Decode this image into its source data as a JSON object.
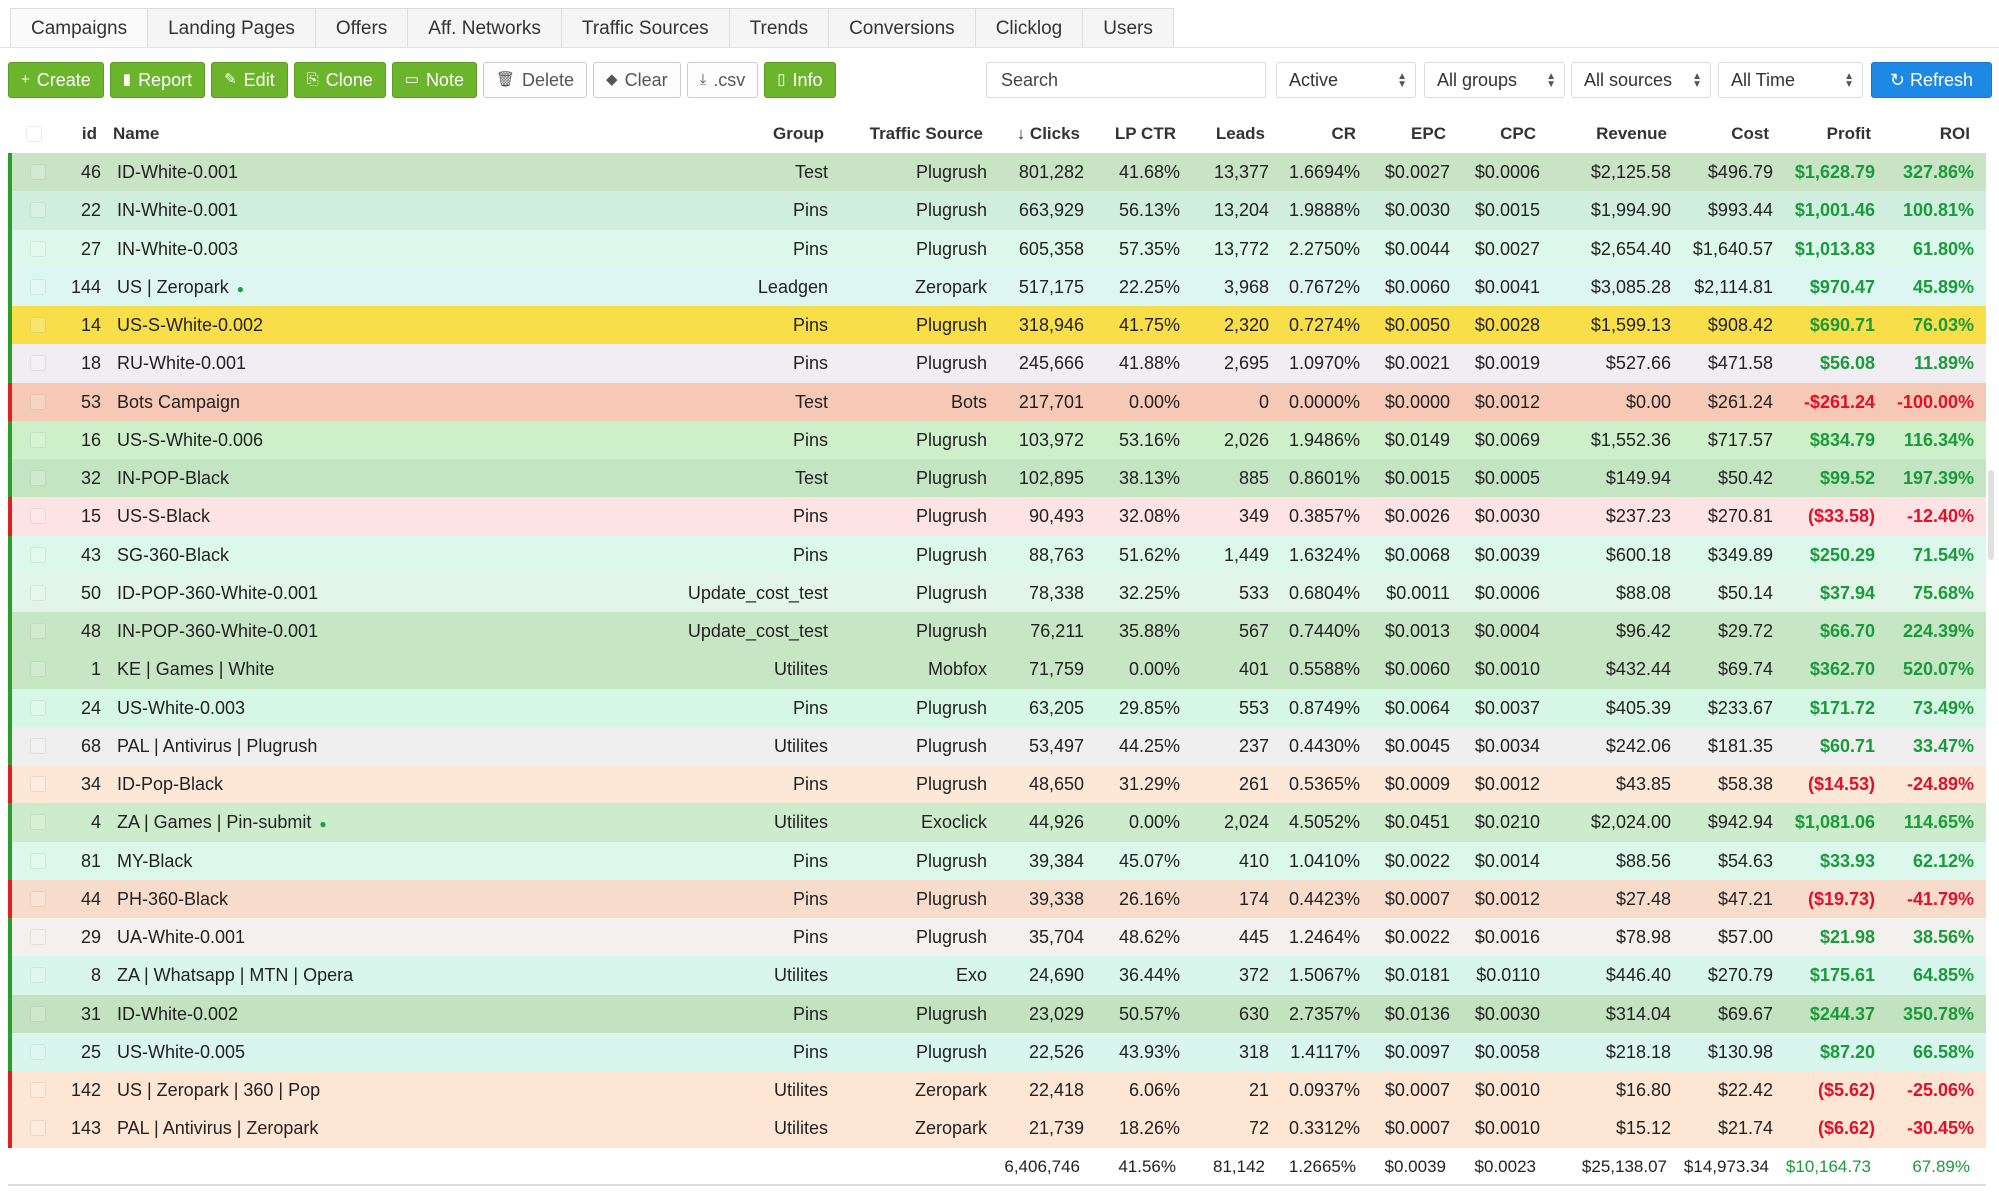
{
  "tabs": [
    "Campaigns",
    "Landing Pages",
    "Offers",
    "Aff. Networks",
    "Traffic Sources",
    "Trends",
    "Conversions",
    "Clicklog",
    "Users"
  ],
  "toolbar": {
    "buttons": [
      {
        "label": "Create",
        "icon": "plus-icon",
        "style": "green"
      },
      {
        "label": "Report",
        "icon": "bar-chart-icon",
        "style": "green"
      },
      {
        "label": "Edit",
        "icon": "pencil-icon",
        "style": "green"
      },
      {
        "label": "Clone",
        "icon": "copy-icon",
        "style": "green"
      },
      {
        "label": "Note",
        "icon": "note-icon",
        "style": "green"
      },
      {
        "label": "Delete",
        "icon": "trash-icon",
        "style": "white"
      },
      {
        "label": "Clear",
        "icon": "eraser-icon",
        "style": "white"
      },
      {
        "label": ".csv",
        "icon": "download-icon",
        "style": "white"
      },
      {
        "label": "Info",
        "icon": "file-icon",
        "style": "green"
      }
    ],
    "search_placeholder": "Search",
    "filters": [
      "Active",
      "All groups",
      "All sources",
      "All Time"
    ],
    "refresh_label": "Refresh"
  },
  "table": {
    "columns": [
      "id",
      "Name",
      "Group",
      "Traffic Source",
      "Clicks",
      "LP CTR",
      "Leads",
      "CR",
      "EPC",
      "CPC",
      "Revenue",
      "Cost",
      "Profit",
      "ROI"
    ],
    "sort_column": "Clicks",
    "sort_direction": "desc",
    "rows": [
      {
        "id": "46",
        "name": "ID-White-0.001",
        "group": "Test",
        "source": "Plugrush",
        "clicks": "801,282",
        "lpctr": "41.68%",
        "leads": "13,377",
        "cr": "1.6694%",
        "epc": "$0.0027",
        "cpc": "$0.0006",
        "revenue": "$2,125.58",
        "cost": "$496.79",
        "profit": "$1,628.79",
        "roi": "327.86%",
        "bg": "#c9e4c5",
        "status": "positive"
      },
      {
        "id": "22",
        "name": "IN-White-0.001",
        "group": "Pins",
        "source": "Plugrush",
        "clicks": "663,929",
        "lpctr": "56.13%",
        "leads": "13,204",
        "cr": "1.9888%",
        "epc": "$0.0030",
        "cpc": "$0.0015",
        "revenue": "$1,994.90",
        "cost": "$993.44",
        "profit": "$1,001.46",
        "roi": "100.81%",
        "bg": "#cfeedd",
        "status": "positive"
      },
      {
        "id": "27",
        "name": "IN-White-0.003",
        "group": "Pins",
        "source": "Plugrush",
        "clicks": "605,358",
        "lpctr": "57.35%",
        "leads": "13,772",
        "cr": "2.2750%",
        "epc": "$0.0044",
        "cpc": "$0.0027",
        "revenue": "$2,654.40",
        "cost": "$1,640.57",
        "profit": "$1,013.83",
        "roi": "61.80%",
        "bg": "#dcf8ec",
        "status": "positive"
      },
      {
        "id": "144",
        "name": "US | Zeropark",
        "dot": true,
        "group": "Leadgen",
        "source": "Zeropark",
        "clicks": "517,175",
        "lpctr": "22.25%",
        "leads": "3,968",
        "cr": "0.7672%",
        "epc": "$0.0060",
        "cpc": "$0.0041",
        "revenue": "$3,085.28",
        "cost": "$2,114.81",
        "profit": "$970.47",
        "roi": "45.89%",
        "bg": "#ddf6f2",
        "status": "positive"
      },
      {
        "id": "14",
        "name": "US-S-White-0.002",
        "group": "Pins",
        "source": "Plugrush",
        "clicks": "318,946",
        "lpctr": "41.75%",
        "leads": "2,320",
        "cr": "0.7274%",
        "epc": "$0.0050",
        "cpc": "$0.0028",
        "revenue": "$1,599.13",
        "cost": "$908.42",
        "profit": "$690.71",
        "roi": "76.03%",
        "bg": "#f8df4a",
        "status": "positive"
      },
      {
        "id": "18",
        "name": "RU-White-0.001",
        "group": "Pins",
        "source": "Plugrush",
        "clicks": "245,666",
        "lpctr": "41.88%",
        "leads": "2,695",
        "cr": "1.0970%",
        "epc": "$0.0021",
        "cpc": "$0.0019",
        "revenue": "$527.66",
        "cost": "$471.58",
        "profit": "$56.08",
        "roi": "11.89%",
        "bg": "#f1eef3",
        "status": "positive"
      },
      {
        "id": "53",
        "name": "Bots Campaign",
        "group": "Test",
        "source": "Bots",
        "clicks": "217,701",
        "lpctr": "0.00%",
        "leads": "0",
        "cr": "0.0000%",
        "epc": "$0.0000",
        "cpc": "$0.0012",
        "revenue": "$0.00",
        "cost": "$261.24",
        "profit": "-$261.24",
        "roi": "-100.00%",
        "bg": "#f6c8b6",
        "status": "negative"
      },
      {
        "id": "16",
        "name": "US-S-White-0.006",
        "group": "Pins",
        "source": "Plugrush",
        "clicks": "103,972",
        "lpctr": "53.16%",
        "leads": "2,026",
        "cr": "1.9486%",
        "epc": "$0.0149",
        "cpc": "$0.0069",
        "revenue": "$1,552.36",
        "cost": "$717.57",
        "profit": "$834.79",
        "roi": "116.34%",
        "bg": "#cdf0c9",
        "status": "positive"
      },
      {
        "id": "32",
        "name": "IN-POP-Black",
        "group": "Test",
        "source": "Plugrush",
        "clicks": "102,895",
        "lpctr": "38.13%",
        "leads": "885",
        "cr": "0.8601%",
        "epc": "$0.0015",
        "cpc": "$0.0005",
        "revenue": "$149.94",
        "cost": "$50.42",
        "profit": "$99.52",
        "roi": "197.39%",
        "bg": "#c3e5c2",
        "status": "positive"
      },
      {
        "id": "15",
        "name": "US-S-Black",
        "group": "Pins",
        "source": "Plugrush",
        "clicks": "90,493",
        "lpctr": "32.08%",
        "leads": "349",
        "cr": "0.3857%",
        "epc": "$0.0026",
        "cpc": "$0.0030",
        "revenue": "$237.23",
        "cost": "$270.81",
        "profit": "($33.58)",
        "roi": "-12.40%",
        "bg": "#fde3e3",
        "status": "negative"
      },
      {
        "id": "43",
        "name": "SG-360-Black",
        "group": "Pins",
        "source": "Plugrush",
        "clicks": "88,763",
        "lpctr": "51.62%",
        "leads": "1,449",
        "cr": "1.6324%",
        "epc": "$0.0068",
        "cpc": "$0.0039",
        "revenue": "$600.18",
        "cost": "$349.89",
        "profit": "$250.29",
        "roi": "71.54%",
        "bg": "#dcf8ec",
        "status": "positive"
      },
      {
        "id": "50",
        "name": "ID-POP-360-White-0.001",
        "group": "Update_cost_test",
        "source": "Plugrush",
        "clicks": "78,338",
        "lpctr": "32.25%",
        "leads": "533",
        "cr": "0.6804%",
        "epc": "$0.0011",
        "cpc": "$0.0006",
        "revenue": "$88.08",
        "cost": "$50.14",
        "profit": "$37.94",
        "roi": "75.68%",
        "bg": "#e2f5e8",
        "status": "positive"
      },
      {
        "id": "48",
        "name": "IN-POP-360-White-0.001",
        "group": "Update_cost_test",
        "source": "Plugrush",
        "clicks": "76,211",
        "lpctr": "35.88%",
        "leads": "567",
        "cr": "0.7440%",
        "epc": "$0.0013",
        "cpc": "$0.0004",
        "revenue": "$96.42",
        "cost": "$29.72",
        "profit": "$66.70",
        "roi": "224.39%",
        "bg": "#c6e6c4",
        "status": "positive"
      },
      {
        "id": "1",
        "name": "KE | Games | White",
        "group": "Utilites",
        "source": "Mobfox",
        "clicks": "71,759",
        "lpctr": "0.00%",
        "leads": "401",
        "cr": "0.5588%",
        "epc": "$0.0060",
        "cpc": "$0.0010",
        "revenue": "$432.44",
        "cost": "$69.74",
        "profit": "$362.70",
        "roi": "520.07%",
        "bg": "#c6e6c4",
        "status": "positive"
      },
      {
        "id": "24",
        "name": "US-White-0.003",
        "group": "Pins",
        "source": "Plugrush",
        "clicks": "63,205",
        "lpctr": "29.85%",
        "leads": "553",
        "cr": "0.8749%",
        "epc": "$0.0064",
        "cpc": "$0.0037",
        "revenue": "$405.39",
        "cost": "$233.67",
        "profit": "$171.72",
        "roi": "73.49%",
        "bg": "#d6f7e5",
        "status": "positive"
      },
      {
        "id": "68",
        "name": "PAL | Antivirus | Plugrush",
        "group": "Utilites",
        "source": "Plugrush",
        "clicks": "53,497",
        "lpctr": "44.25%",
        "leads": "237",
        "cr": "0.4430%",
        "epc": "$0.0045",
        "cpc": "$0.0034",
        "revenue": "$242.06",
        "cost": "$181.35",
        "profit": "$60.71",
        "roi": "33.47%",
        "bg": "#f0efef",
        "status": "positive"
      },
      {
        "id": "34",
        "name": "ID-Pop-Black",
        "group": "Pins",
        "source": "Plugrush",
        "clicks": "48,650",
        "lpctr": "31.29%",
        "leads": "261",
        "cr": "0.5365%",
        "epc": "$0.0009",
        "cpc": "$0.0012",
        "revenue": "$43.85",
        "cost": "$58.38",
        "profit": "($14.53)",
        "roi": "-24.89%",
        "bg": "#fde8d8",
        "status": "negative"
      },
      {
        "id": "4",
        "name": "ZA | Games | Pin-submit",
        "dot": true,
        "group": "Utilites",
        "source": "Exoclick",
        "clicks": "44,926",
        "lpctr": "0.00%",
        "leads": "2,024",
        "cr": "4.5052%",
        "epc": "$0.0451",
        "cpc": "$0.0210",
        "revenue": "$2,024.00",
        "cost": "$942.94",
        "profit": "$1,081.06",
        "roi": "114.65%",
        "bg": "#cdeccb",
        "status": "positive"
      },
      {
        "id": "81",
        "name": "MY-Black",
        "group": "Pins",
        "source": "Plugrush",
        "clicks": "39,384",
        "lpctr": "45.07%",
        "leads": "410",
        "cr": "1.0410%",
        "epc": "$0.0022",
        "cpc": "$0.0014",
        "revenue": "$88.56",
        "cost": "$54.63",
        "profit": "$33.93",
        "roi": "62.12%",
        "bg": "#dcf8ec",
        "status": "positive"
      },
      {
        "id": "44",
        "name": "PH-360-Black",
        "group": "Pins",
        "source": "Plugrush",
        "clicks": "39,338",
        "lpctr": "26.16%",
        "leads": "174",
        "cr": "0.4423%",
        "epc": "$0.0007",
        "cpc": "$0.0012",
        "revenue": "$27.48",
        "cost": "$47.21",
        "profit": "($19.73)",
        "roi": "-41.79%",
        "bg": "#f8dccb",
        "status": "negative"
      },
      {
        "id": "29",
        "name": "UA-White-0.001",
        "group": "Pins",
        "source": "Plugrush",
        "clicks": "35,704",
        "lpctr": "48.62%",
        "leads": "445",
        "cr": "1.2464%",
        "epc": "$0.0022",
        "cpc": "$0.0016",
        "revenue": "$78.98",
        "cost": "$57.00",
        "profit": "$21.98",
        "roi": "38.56%",
        "bg": "#f2f1ed",
        "status": "positive"
      },
      {
        "id": "8",
        "name": "ZA | Whatsapp | MTN | Opera",
        "group": "Utilites",
        "source": "Exo",
        "clicks": "24,690",
        "lpctr": "36.44%",
        "leads": "372",
        "cr": "1.5067%",
        "epc": "$0.0181",
        "cpc": "$0.0110",
        "revenue": "$446.40",
        "cost": "$270.79",
        "profit": "$175.61",
        "roi": "64.85%",
        "bg": "#d9f6ec",
        "status": "positive"
      },
      {
        "id": "31",
        "name": "ID-White-0.002",
        "group": "Pins",
        "source": "Plugrush",
        "clicks": "23,029",
        "lpctr": "50.57%",
        "leads": "630",
        "cr": "2.7357%",
        "epc": "$0.0136",
        "cpc": "$0.0030",
        "revenue": "$314.04",
        "cost": "$69.67",
        "profit": "$244.37",
        "roi": "350.78%",
        "bg": "#c3e2bf",
        "status": "positive"
      },
      {
        "id": "25",
        "name": "US-White-0.005",
        "group": "Pins",
        "source": "Plugrush",
        "clicks": "22,526",
        "lpctr": "43.93%",
        "leads": "318",
        "cr": "1.4117%",
        "epc": "$0.0097",
        "cpc": "$0.0058",
        "revenue": "$218.18",
        "cost": "$130.98",
        "profit": "$87.20",
        "roi": "66.58%",
        "bg": "#d9f6ee",
        "status": "positive"
      },
      {
        "id": "142",
        "name": "US | Zeropark | 360 | Pop",
        "group": "Utilites",
        "source": "Zeropark",
        "clicks": "22,418",
        "lpctr": "6.06%",
        "leads": "21",
        "cr": "0.0937%",
        "epc": "$0.0007",
        "cpc": "$0.0010",
        "revenue": "$16.80",
        "cost": "$22.42",
        "profit": "($5.62)",
        "roi": "-25.06%",
        "bg": "#fde6d3",
        "status": "negative"
      },
      {
        "id": "143",
        "name": "PAL | Antivirus | Zeropark",
        "group": "Utilites",
        "source": "Zeropark",
        "clicks": "21,739",
        "lpctr": "18.26%",
        "leads": "72",
        "cr": "0.3312%",
        "epc": "$0.0007",
        "cpc": "$0.0010",
        "revenue": "$15.12",
        "cost": "$21.74",
        "profit": "($6.62)",
        "roi": "-30.45%",
        "bg": "#fde6d3",
        "status": "negative"
      }
    ],
    "totals": {
      "clicks": "6,406,746",
      "lpctr": "41.56%",
      "leads": "81,142",
      "cr": "1.2665%",
      "epc": "$0.0039",
      "cpc": "$0.0023",
      "revenue": "$25,138.07",
      "cost": "$14,973.34",
      "profit": "$10,164.73",
      "roi": "67.89%"
    }
  }
}
